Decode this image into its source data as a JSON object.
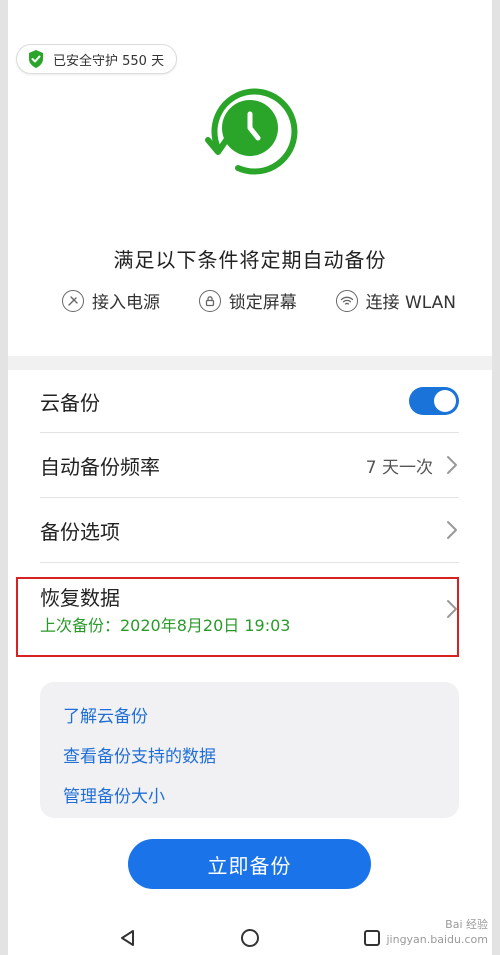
{
  "badge": {
    "text": "已安全守护 550 天"
  },
  "hero": {
    "title": "满足以下条件将定期自动备份"
  },
  "conditions": [
    {
      "icon": "plug-icon",
      "label": "接入电源"
    },
    {
      "icon": "lock-icon",
      "label": "锁定屏幕"
    },
    {
      "icon": "wifi-icon",
      "label": "连接 WLAN"
    }
  ],
  "settings": {
    "cloud_backup": {
      "label": "云备份",
      "enabled": true
    },
    "auto_frequency": {
      "label": "自动备份频率",
      "value": "7 天一次"
    },
    "backup_options": {
      "label": "备份选项"
    },
    "restore": {
      "label": "恢复数据",
      "last_backup": "上次备份：2020年8月20日  19:03"
    }
  },
  "links": [
    {
      "label": "了解云备份"
    },
    {
      "label": "查看备份支持的数据"
    },
    {
      "label": "管理备份大小"
    }
  ],
  "backup_button": {
    "label": "立即备份"
  },
  "watermark": {
    "line1": "Bai 经验",
    "line2": "jingyan.baidu.com"
  },
  "colors": {
    "accent": "#1a73e8",
    "green": "#2aa52a",
    "highlight": "#d62222"
  }
}
